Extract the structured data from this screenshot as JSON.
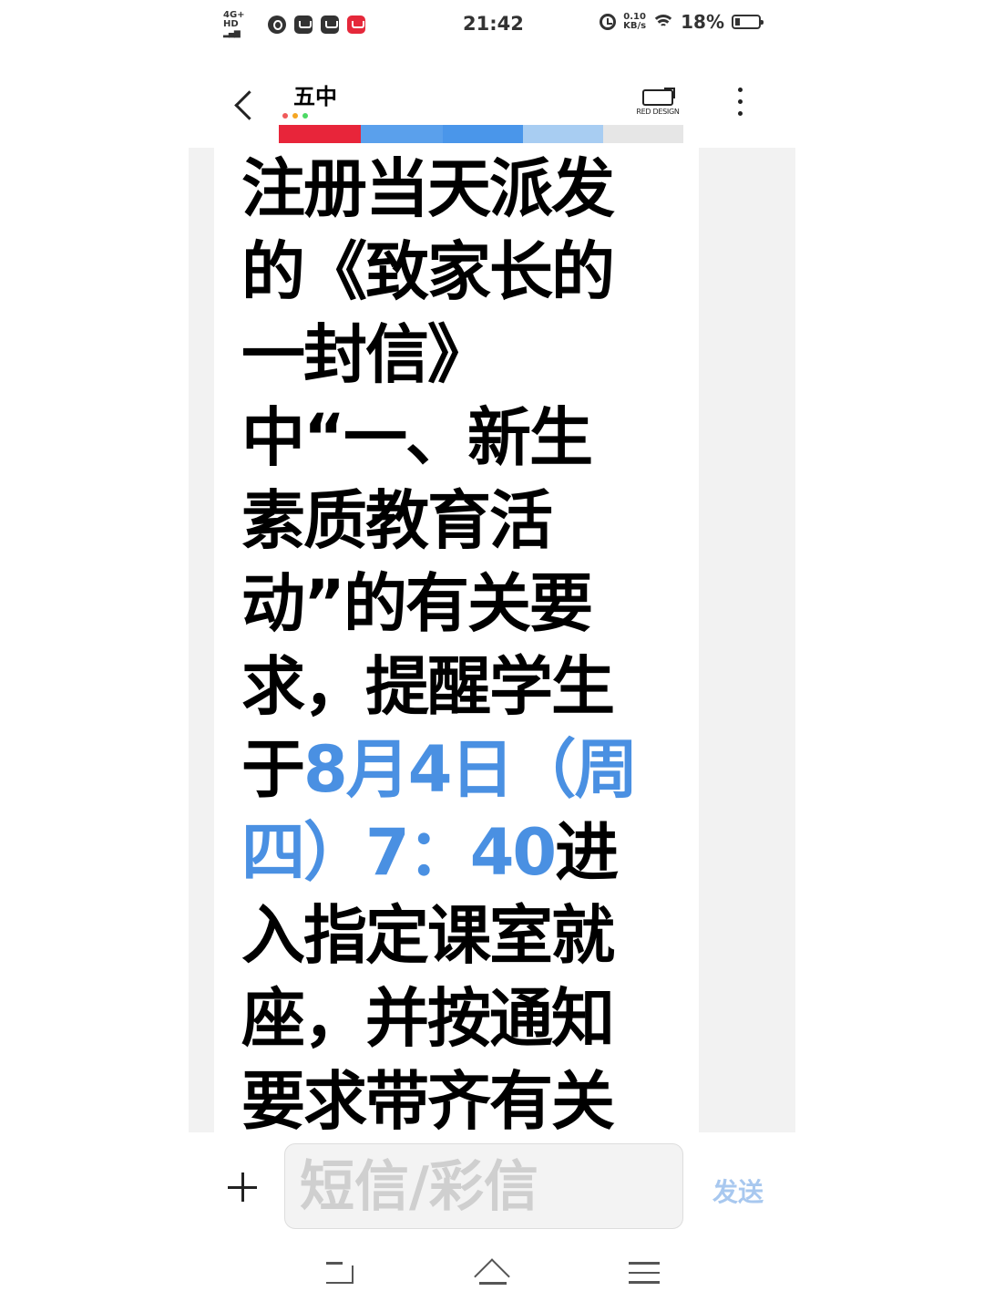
{
  "status_bar": {
    "network": "4G+ HD",
    "signal": "▂▄▆",
    "time": "21:42",
    "speed_value": "0.10",
    "speed_unit": "KB/s",
    "battery": "18%",
    "battery_level": 0.18
  },
  "header": {
    "title": "五中",
    "brand": "RED DESIGN",
    "dot_colors": [
      "#f05a5a",
      "#f5a623",
      "#4cd964"
    ],
    "strip_colors": [
      "#e8253a",
      "#5aa0ec",
      "#4a96ea",
      "#a8cdf2",
      "#e6e6e6"
    ]
  },
  "message": {
    "lines": [
      {
        "text": "注册当天派发"
      },
      {
        "text": "的《致家长的"
      },
      {
        "text": "一封信》"
      },
      {
        "text": "中“一、新生"
      },
      {
        "text": "素质教育活"
      },
      {
        "text": "动”的有关要"
      },
      {
        "text": "求，提醒学生"
      },
      {
        "pre": "于",
        "hl": "8月4日（周",
        "post": ""
      },
      {
        "pre": "",
        "hl": "四）7：40",
        "post": "进"
      },
      {
        "text": "入指定课室就"
      },
      {
        "text": "座，并按通知"
      },
      {
        "text": "要求带齐有关"
      }
    ],
    "highlight_color": "#4a90e2"
  },
  "input_bar": {
    "placeholder": "短信/彩信",
    "send_label": "发送"
  },
  "nav_bar": {
    "icons": [
      "back-icon",
      "home-icon",
      "menu-icon"
    ]
  }
}
